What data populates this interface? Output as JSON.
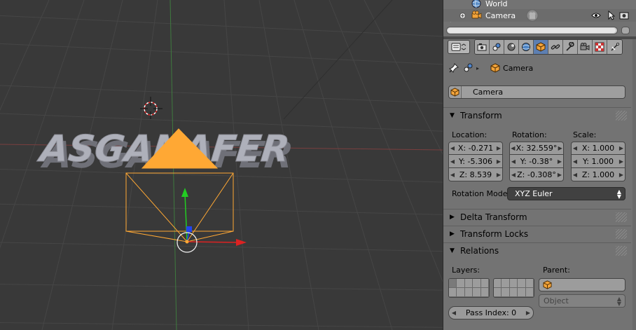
{
  "viewport": {
    "text_object": "ASGANAFER"
  },
  "outliner": {
    "rows": [
      {
        "label": "World",
        "icon": "world-icon"
      },
      {
        "label": "Camera",
        "icon": "camera-object-icon"
      }
    ],
    "row_controls": [
      "eye-icon",
      "cursor-select-icon",
      "render-camera-icon"
    ]
  },
  "properties": {
    "context_tabs": [
      "render",
      "render-layers",
      "scene",
      "world",
      "object",
      "constraints",
      "modifiers",
      "data",
      "material",
      "texture"
    ],
    "active_tab": "object",
    "breadcrumb": {
      "label": "Camera"
    },
    "object_name": "Camera",
    "transform": {
      "title": "Transform",
      "location_label": "Location:",
      "rotation_label": "Rotation:",
      "scale_label": "Scale:",
      "location": [
        "X: -0.271",
        "Y: -5.306",
        "Z: 8.539"
      ],
      "rotation": [
        "X: 32.559°",
        "Y: -0.38°",
        "Z: -0.308°"
      ],
      "scale": [
        "X: 1.000",
        "Y: 1.000",
        "Z: 1.000"
      ],
      "rotation_mode_label": "Rotation Mode:",
      "rotation_mode": "XYZ Euler"
    },
    "delta_transform": {
      "title": "Delta Transform"
    },
    "transform_locks": {
      "title": "Transform Locks"
    },
    "relations": {
      "title": "Relations",
      "layers_label": "Layers:",
      "parent_label": "Parent:",
      "parent_value": "",
      "parent_type": "Object",
      "pass_index": "Pass Index: 0"
    }
  },
  "colors": {
    "active_tab": "#5d7fb2",
    "selection_orange": "#ffa834",
    "axis_x": "#dd2222",
    "axis_y": "#22cc22",
    "axis_z": "#2244ee"
  }
}
